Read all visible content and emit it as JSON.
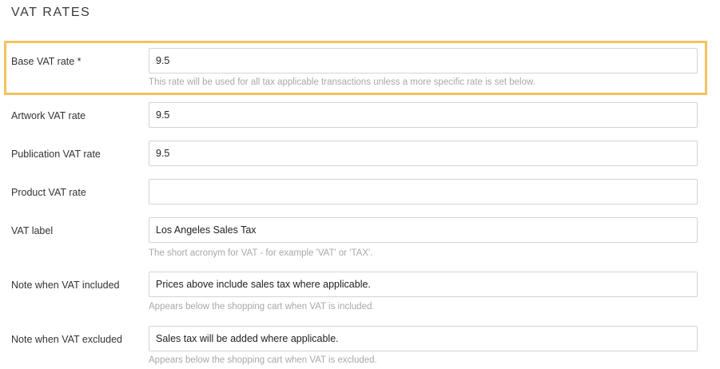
{
  "section": {
    "title": "VAT RATES"
  },
  "fields": [
    {
      "label": "Base VAT rate *",
      "value": "9.5",
      "hint": "This rate will be used for all tax applicable transactions unless a more specific rate is set below.",
      "highlighted": true
    },
    {
      "label": "Artwork VAT rate",
      "value": "9.5",
      "hint": ""
    },
    {
      "label": "Publication VAT rate",
      "value": "9.5",
      "hint": ""
    },
    {
      "label": "Product VAT rate",
      "value": "",
      "hint": ""
    },
    {
      "label": "VAT label",
      "value": "Los Angeles Sales Tax",
      "hint": "The short acronym for VAT - for example 'VAT' or 'TAX'."
    },
    {
      "label": "Note when VAT included",
      "value": "Prices above include sales tax where applicable.",
      "hint": "Appears below the shopping cart when VAT is included."
    },
    {
      "label": "Note when VAT excluded",
      "value": "Sales tax will be added where applicable.",
      "hint": "Appears below the shopping cart when VAT is excluded."
    }
  ],
  "colors": {
    "highlight_border": "#f6c15f",
    "hint_text": "#a8a8a8",
    "input_border": "#d4d4d4"
  }
}
